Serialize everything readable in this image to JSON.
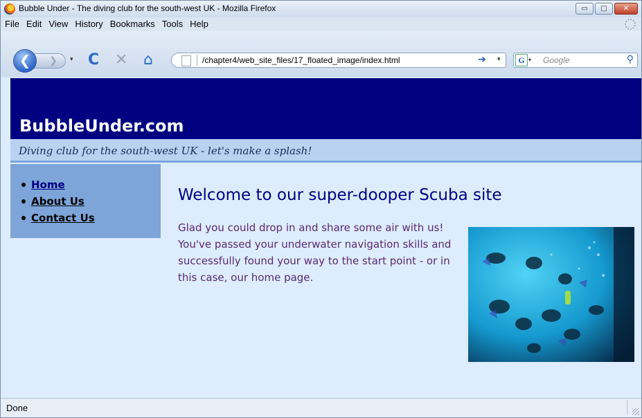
{
  "window": {
    "title": "Bubble Under - The diving club for the south-west UK - Mozilla Firefox",
    "controls": {
      "minimize": "▭",
      "maximize": "□",
      "close": "✕"
    }
  },
  "menu": {
    "file": "File",
    "edit": "Edit",
    "view": "View",
    "history": "History",
    "bookmarks": "Bookmarks",
    "tools": "Tools",
    "help": "Help"
  },
  "toolbar": {
    "back_icon": "❮",
    "forward_icon": "❯",
    "reload_icon": "C",
    "stop_icon": "✕",
    "home_icon": "⌂",
    "dropdown_icon": "▾",
    "go_icon": "➔",
    "url": "/chapter4/web_site_files/17_floated_image/index.html",
    "search_engine_icon": "G",
    "search_placeholder": "Google",
    "search_icon": "⚲"
  },
  "page": {
    "site_name": "BubbleUnder.com",
    "tagline": "Diving club for the south-west UK - let's make a splash!",
    "nav": [
      {
        "label": "Home",
        "current": true
      },
      {
        "label": "About Us",
        "current": false
      },
      {
        "label": "Contact Us",
        "current": false
      }
    ],
    "heading": "Welcome to our super-dooper Scuba site",
    "body": "Glad you could drop in and share some air with us! You've passed your underwater navigation skills and successfully found your way to the start point - or in this case, our home page.",
    "image_subject": "divers-underwater-photo"
  },
  "status": {
    "text": "Done"
  },
  "colors": {
    "header_bg": "#000080",
    "tagline_bg": "#b8d2f0",
    "nav_bg": "#7da5d9",
    "content_bg": "#ddecff",
    "heading": "#000080",
    "body_text": "#5a2a70"
  }
}
